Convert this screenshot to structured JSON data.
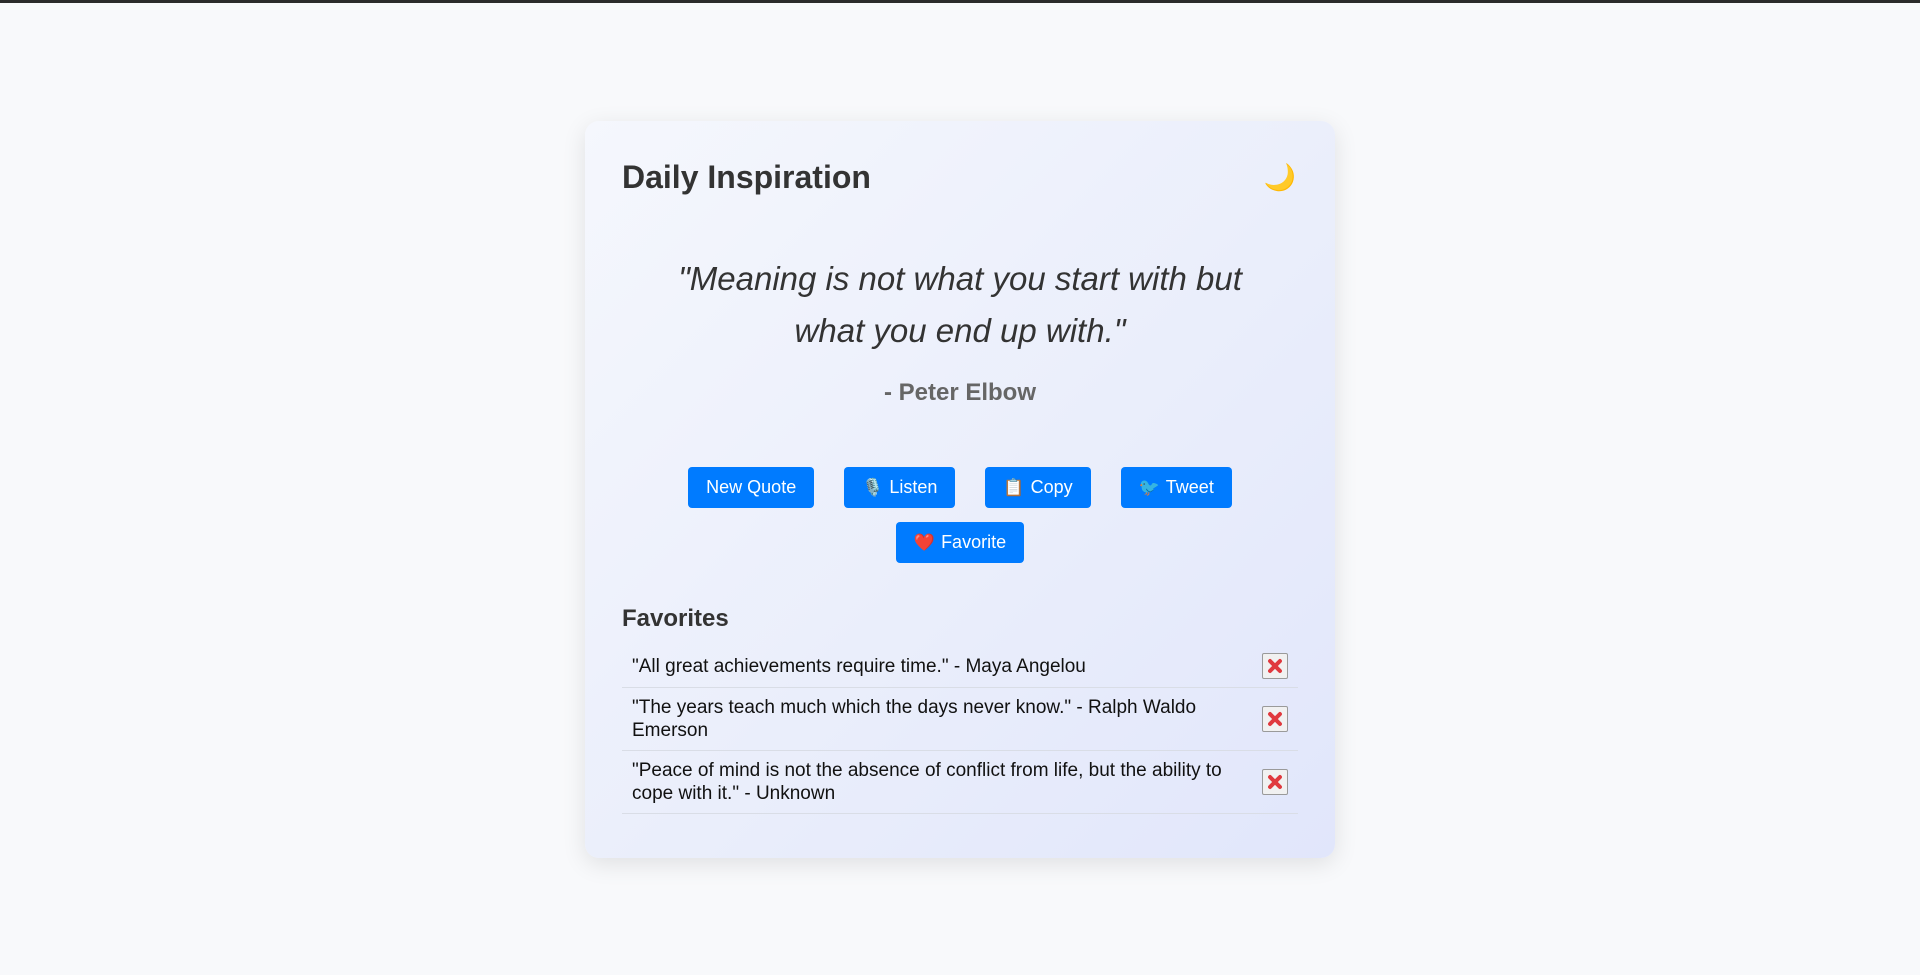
{
  "app": {
    "title": "Daily Inspiration",
    "theme_toggle_icon": "moon-icon",
    "theme_toggle_glyph": "🌙"
  },
  "quote": {
    "text": "\"Meaning is not what you start with but what you end up with.\"",
    "author": "- Peter Elbow"
  },
  "actions": [
    {
      "name": "new-quote-button",
      "icon": "",
      "label": "New Quote"
    },
    {
      "name": "listen-button",
      "icon": "🎙️",
      "icon_name": "microphone-icon",
      "label": "Listen"
    },
    {
      "name": "copy-button",
      "icon": "📋",
      "icon_name": "clipboard-icon",
      "label": "Copy"
    },
    {
      "name": "tweet-button",
      "icon": "🐦",
      "icon_name": "bird-icon",
      "label": "Tweet"
    },
    {
      "name": "favorite-button",
      "icon": "❤️",
      "icon_name": "heart-icon",
      "label": "Favorite"
    }
  ],
  "favorites": {
    "heading": "Favorites",
    "items": [
      {
        "text": "\"All great achievements require time.\" - Maya Angelou"
      },
      {
        "text": "\"The years teach much which the days never know.\" - Ralph Waldo Emerson"
      },
      {
        "text": "\"Peace of mind is not the absence of conflict from life, but the ability to cope with it.\" - Unknown"
      }
    ],
    "remove_icon": "close-icon"
  },
  "colors": {
    "button_bg": "#007bff",
    "button_text": "#ffffff",
    "text_primary": "#333333",
    "author_text": "#666666",
    "page_bg": "#f8f9fb",
    "remove_x": "#e0393e"
  }
}
